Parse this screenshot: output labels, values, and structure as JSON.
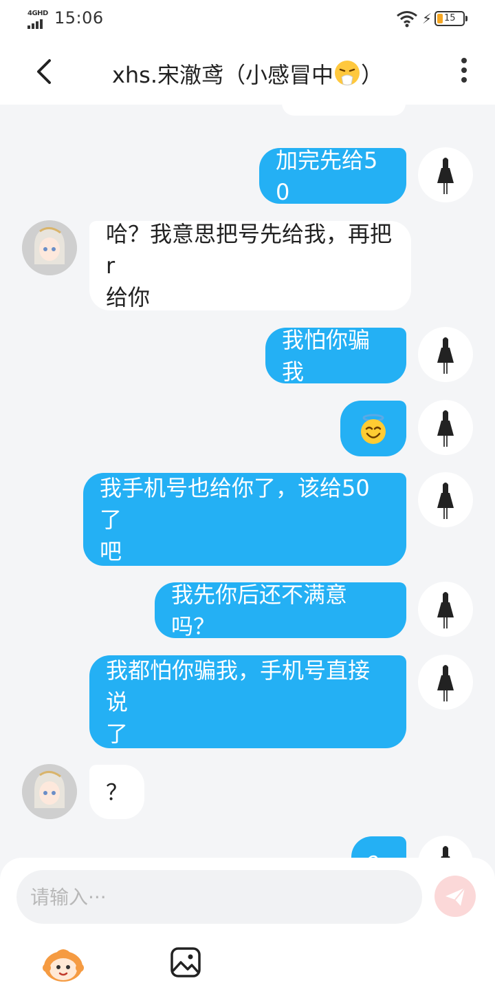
{
  "status_bar": {
    "network": "4GHD",
    "time": "15:06",
    "battery_level": "15"
  },
  "header": {
    "title": "xhs.宋澈鸢（小感冒中",
    "title_suffix": "）",
    "title_emoji": "sneezing-face-emoji"
  },
  "messages": [
    {
      "sender": "me",
      "text": "加完先给50"
    },
    {
      "sender": "other",
      "text": "哈？我意思把号先给我，再把r\n给你"
    },
    {
      "sender": "me",
      "text": "我怕你骗我"
    },
    {
      "sender": "me",
      "emoji": "smiling-face-with-halo"
    },
    {
      "sender": "me",
      "text": "我手机号也给你了，该给50了\n吧"
    },
    {
      "sender": "me",
      "text": "我先你后还不满意吗？"
    },
    {
      "sender": "me",
      "text": "我都怕你骗我，手机号直接说\n了"
    },
    {
      "sender": "other",
      "text": "？"
    },
    {
      "sender": "me",
      "text": "？"
    }
  ],
  "composer": {
    "placeholder": "请输入···",
    "value": ""
  },
  "colors": {
    "my_bubble": "#24b0f4",
    "other_bubble": "#ffffff",
    "background": "#f4f5f7",
    "send_button": "#fbd8d8"
  },
  "icons": {
    "back": "chevron-left-icon",
    "more": "more-vertical-icon",
    "send": "paper-plane-icon",
    "mascot": "mascot-sticker-icon",
    "image": "image-gallery-icon"
  }
}
